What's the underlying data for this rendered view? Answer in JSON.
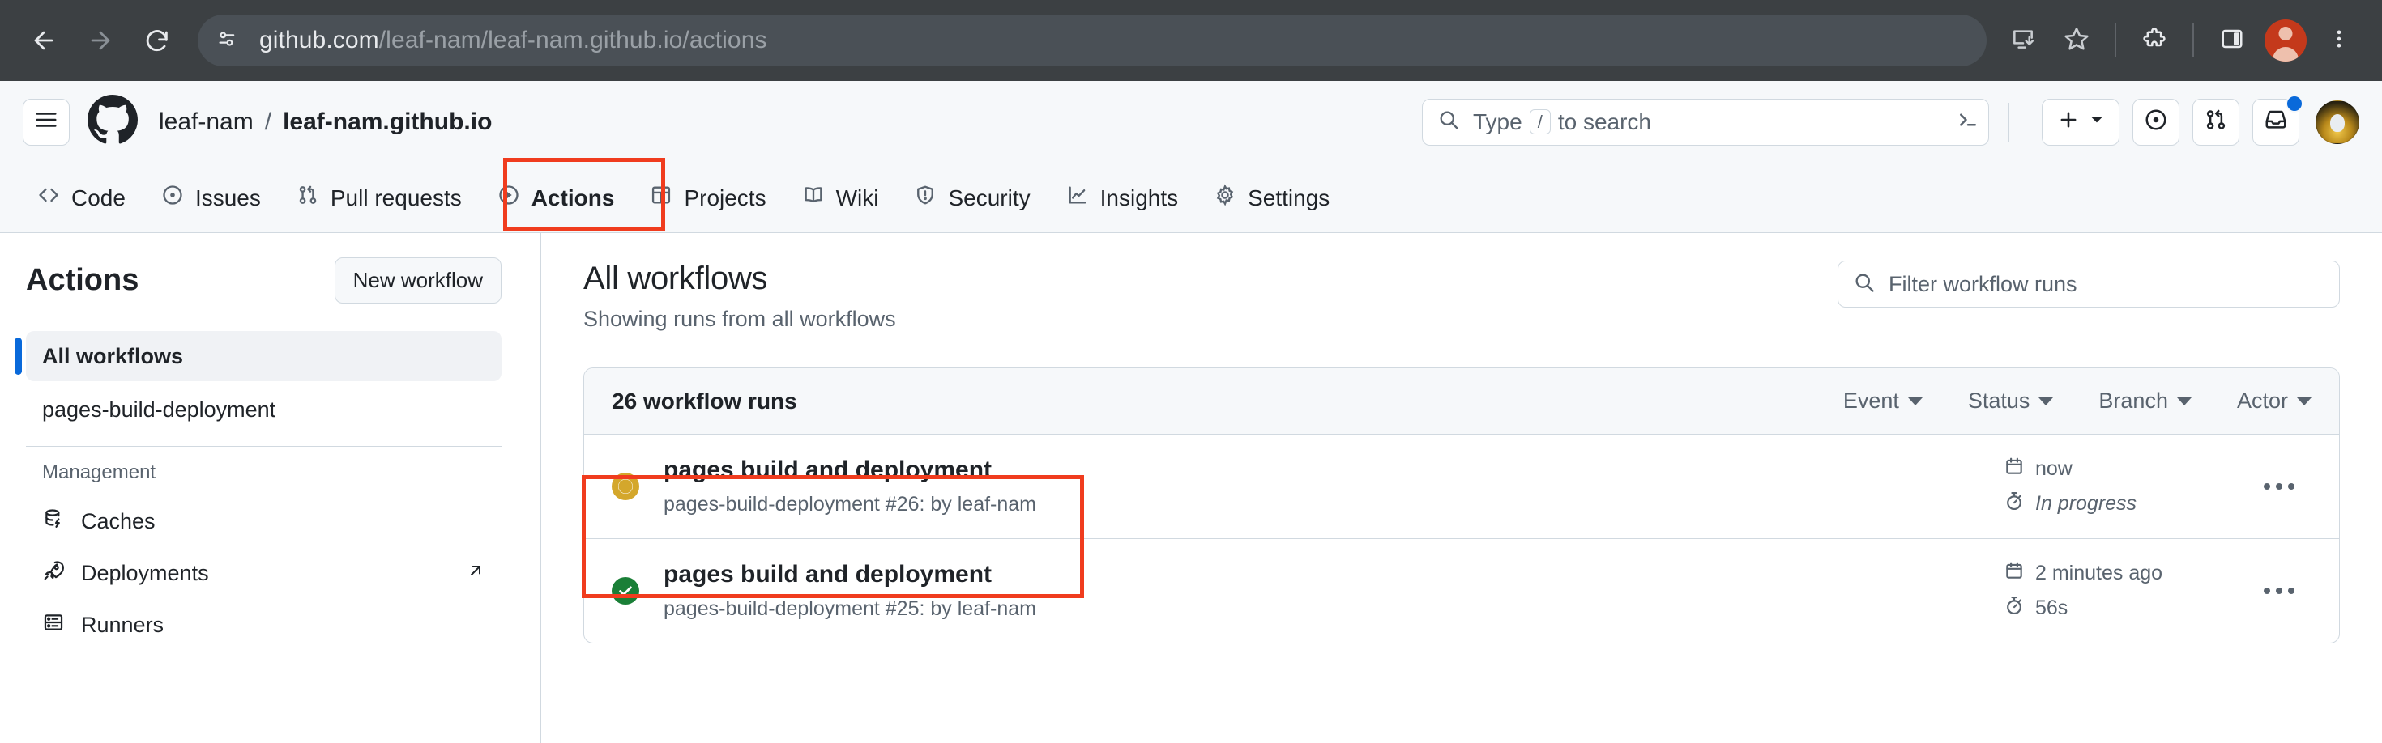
{
  "browser": {
    "back_icon": "arrow-left-icon",
    "forward_icon": "arrow-right-icon",
    "reload_icon": "reload-icon",
    "site_info_icon": "site-settings-icon",
    "url_prefix": "github.com",
    "url_suffix": "/leaf-nam/leaf-nam.github.io/actions",
    "install_icon": "install-app-icon",
    "bookmark_icon": "star-icon",
    "extensions_icon": "puzzle-icon",
    "side_panel_icon": "side-panel-icon",
    "profile_icon": "profile-avatar-icon",
    "menu_icon": "three-dot-menu-icon"
  },
  "gh_header": {
    "hamburger_icon": "hamburger-menu-icon",
    "logo_icon": "github-octocat-logo",
    "owner": "leaf-nam",
    "separator": "/",
    "repo": "leaf-nam.github.io",
    "search": {
      "icon": "search-icon",
      "placeholder_before": "Type",
      "key": "/",
      "placeholder_after": "to search",
      "terminal_icon": "command-palette-icon"
    },
    "create_new_label": "+",
    "create_new_icon": "plus-icon",
    "create_new_caret_icon": "chevron-down-icon",
    "issues_icon": "issue-opened-icon",
    "pull_requests_icon": "git-pull-request-icon",
    "inbox_icon": "inbox-icon",
    "has_notification": true,
    "avatar_icon": "user-avatar"
  },
  "repo_nav": {
    "tabs": [
      {
        "label": "Code",
        "icon": "code-icon",
        "active": false
      },
      {
        "label": "Issues",
        "icon": "issue-opened-icon",
        "active": false
      },
      {
        "label": "Pull requests",
        "icon": "git-pull-request-icon",
        "active": false
      },
      {
        "label": "Actions",
        "icon": "play-circle-icon",
        "active": true
      },
      {
        "label": "Projects",
        "icon": "table-icon",
        "active": false
      },
      {
        "label": "Wiki",
        "icon": "book-icon",
        "active": false
      },
      {
        "label": "Security",
        "icon": "shield-icon",
        "active": false
      },
      {
        "label": "Insights",
        "icon": "graph-icon",
        "active": false
      },
      {
        "label": "Settings",
        "icon": "gear-icon",
        "active": false
      }
    ]
  },
  "sidebar": {
    "title": "Actions",
    "new_workflow_button": "New workflow",
    "all_workflows": "All workflows",
    "workflows": [
      {
        "label": "pages-build-deployment"
      }
    ],
    "management_label": "Management",
    "management_items": [
      {
        "label": "Caches",
        "icon": "cache-icon",
        "external": false
      },
      {
        "label": "Deployments",
        "icon": "rocket-icon",
        "external": true
      },
      {
        "label": "Runners",
        "icon": "server-icon",
        "external": false
      }
    ]
  },
  "main": {
    "title": "All workflows",
    "subtitle": "Showing runs from all workflows",
    "filter": {
      "icon": "search-icon",
      "placeholder": "Filter workflow runs",
      "value": ""
    },
    "runs_count_label": "26 workflow runs",
    "filters": [
      {
        "label": "Event"
      },
      {
        "label": "Status"
      },
      {
        "label": "Branch"
      },
      {
        "label": "Actor"
      }
    ],
    "runs": [
      {
        "status": "in_progress",
        "status_icon": "in-progress-ring-icon",
        "status_color": "#d4a72c",
        "title": "pages build and deployment",
        "subtitle": "pages-build-deployment #26: by leaf-nam",
        "date_icon": "calendar-icon",
        "date": "now",
        "duration_icon": "stopwatch-icon",
        "duration": "In progress",
        "duration_italic": true,
        "kebab_icon": "kebab-horizontal-icon"
      },
      {
        "status": "success",
        "status_icon": "check-circle-fill-icon",
        "status_color": "#1a7f37",
        "title": "pages build and deployment",
        "subtitle": "pages-build-deployment #25: by leaf-nam",
        "date_icon": "calendar-icon",
        "date": "2 minutes ago",
        "duration_icon": "stopwatch-icon",
        "duration": "56s",
        "duration_italic": false,
        "kebab_icon": "kebab-horizontal-icon"
      }
    ]
  },
  "annotations": {
    "color": "#f03c1e",
    "boxes": [
      {
        "target": "actions-tab"
      },
      {
        "target": "first-workflow-run-row"
      }
    ]
  }
}
